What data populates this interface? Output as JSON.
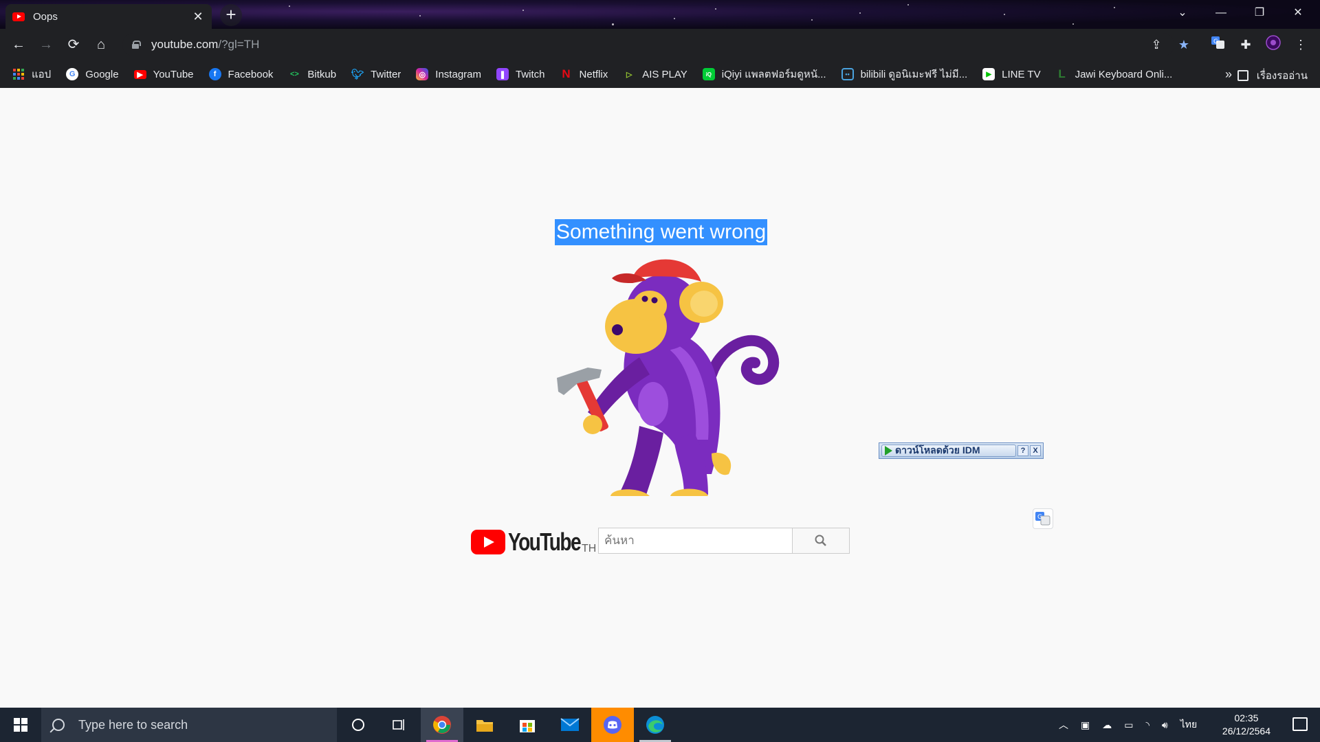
{
  "browser": {
    "tab_title": "Oops",
    "tab_close": "✕",
    "new_tab": "+",
    "url_host": "youtube.com",
    "url_rest": "/?gl=TH"
  },
  "bookmarks": [
    {
      "label": "แอป",
      "icon": "apps-grid-icon",
      "color": "#4285f4"
    },
    {
      "label": "Google",
      "icon": "google-icon",
      "color": "#ffffff"
    },
    {
      "label": "YouTube",
      "icon": "youtube-icon",
      "color": "#ff0000"
    },
    {
      "label": "Facebook",
      "icon": "facebook-icon",
      "color": "#1877f2"
    },
    {
      "label": "Bitkub",
      "icon": "bitkub-icon",
      "color": "#22c55e"
    },
    {
      "label": "Twitter",
      "icon": "twitter-icon",
      "color": "#1da1f2"
    },
    {
      "label": "Instagram",
      "icon": "instagram-icon",
      "color": "#d6249f"
    },
    {
      "label": "Twitch",
      "icon": "twitch-icon",
      "color": "#9146ff"
    },
    {
      "label": "Netflix",
      "icon": "netflix-icon",
      "color": "#e50914"
    },
    {
      "label": "AIS PLAY",
      "icon": "ais-play-icon",
      "color": "#9acd32"
    },
    {
      "label": "iQiyi แพลตฟอร์มดูหนั...",
      "icon": "iqiyi-icon",
      "color": "#00cc36"
    },
    {
      "label": "bilibili ดูอนิเมะฟรี ไม่มี...",
      "icon": "bilibili-icon",
      "color": "#4aa3df"
    },
    {
      "label": "LINE TV",
      "icon": "line-tv-icon",
      "color": "#00c300"
    },
    {
      "label": "Jawi Keyboard Onli...",
      "icon": "jawi-icon",
      "color": "#2e7d32"
    }
  ],
  "bookmarks_more": "»",
  "reading_list": "เรื่องรออ่าน",
  "page": {
    "error_title": "Something went wrong",
    "logo_word": "YouTube",
    "country_code": "TH",
    "search_placeholder": "ค้นหา"
  },
  "idm": {
    "label": "ดาวน์โหลดด้วย IDM",
    "help": "?",
    "close": "X"
  },
  "taskbar": {
    "search_placeholder": "Type here to search",
    "language": "ไทย",
    "time": "02:35",
    "date": "26/12/2564"
  }
}
